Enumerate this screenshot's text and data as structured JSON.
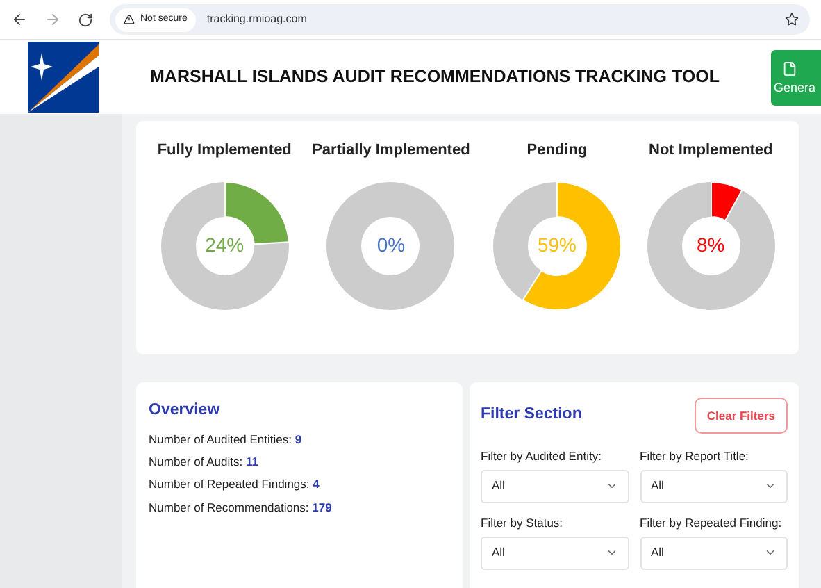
{
  "browser": {
    "security": "Not secure",
    "url": "tracking.rmioag.com"
  },
  "header": {
    "title": "MARSHALL ISLANDS AUDIT RECOMMENDATIONS TRACKING TOOL",
    "button": "Genera"
  },
  "status_charts": [
    {
      "title": "Fully Implemented",
      "value": "24%",
      "color": "#70ad47"
    },
    {
      "title": "Partially Implemented",
      "value": "0%",
      "color": "#4472c4"
    },
    {
      "title": "Pending",
      "value": "59%",
      "color": "#ffc000"
    },
    {
      "title": "Not Implemented",
      "value": "8%",
      "color": "#ff0000"
    }
  ],
  "overview": {
    "title": "Overview",
    "stats": [
      {
        "label": "Number of Audited Entities:",
        "value": "9"
      },
      {
        "label": "Number of Audits:",
        "value": "11"
      },
      {
        "label": "Number of Repeated Findings:",
        "value": "4"
      },
      {
        "label": "Number of Recommendations:",
        "value": "179"
      }
    ]
  },
  "filters": {
    "title": "Filter Section",
    "clear_button": "Clear Filters",
    "fields": [
      {
        "label": "Filter by Audited Entity:",
        "value": "All"
      },
      {
        "label": "Filter by Report Title:",
        "value": "All"
      },
      {
        "label": "Filter by Status:",
        "value": "All"
      },
      {
        "label": "Filter by Repeated Finding:",
        "value": "All"
      }
    ]
  }
}
